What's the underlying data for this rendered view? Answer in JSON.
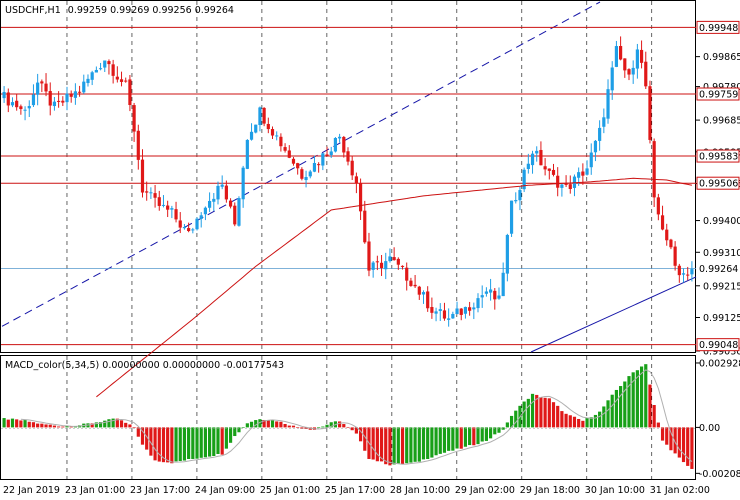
{
  "header": {
    "symbol_label": "USDCHF,H1",
    "ohlc_label": "0.99259 0.99269 0.99256 0.99264"
  },
  "colors": {
    "bull": "#1e9ee6",
    "bear": "#e01818",
    "ma": "#cc1111",
    "hline": "#cc1111",
    "trend": "#1616a8",
    "macd_up": "#18a018",
    "macd_down": "#e01818",
    "signal": "#b0b0b0",
    "current": "#5599cc"
  },
  "chart_data": [
    {
      "type": "candlestick",
      "title": "USDCHF,H1",
      "price_range": [
        0.9903,
        1.0002
      ],
      "y_ticks": [
        "0.99865",
        "0.99780",
        "0.99685",
        "0.99595",
        "0.99505",
        "0.99400",
        "0.99310",
        "0.99215",
        "0.99125",
        "0.99030"
      ],
      "horizontal_levels": [
        "0.99948",
        "0.99759",
        "0.99583",
        "0.99506",
        "0.99048"
      ],
      "current_price": "0.99264",
      "x_labels": [
        "22 Jan 2019",
        "23 Jan 01:00",
        "23 Jan 17:00",
        "24 Jan 09:00",
        "25 Jan 01:00",
        "25 Jan 17:00",
        "28 Jan 10:00",
        "29 Jan 02:00",
        "29 Jan 18:00",
        "30 Jan 10:00",
        "31 Jan 02:00"
      ],
      "bar_count": 165,
      "anchors": [
        [
          0,
          0.9975
        ],
        [
          5,
          0.9971
        ],
        [
          8,
          0.9979
        ],
        [
          12,
          0.9972
        ],
        [
          18,
          0.9977
        ],
        [
          24,
          0.9986
        ],
        [
          29,
          0.9978
        ],
        [
          31,
          0.9966
        ],
        [
          33,
          0.9949
        ],
        [
          36,
          0.9945
        ],
        [
          40,
          0.9942
        ],
        [
          44,
          0.9936
        ],
        [
          48,
          0.9945
        ],
        [
          52,
          0.995
        ],
        [
          55,
          0.9939
        ],
        [
          58,
          0.9964
        ],
        [
          61,
          0.9971
        ],
        [
          66,
          0.9962
        ],
        [
          71,
          0.9953
        ],
        [
          75,
          0.9957
        ],
        [
          80,
          0.9964
        ],
        [
          84,
          0.9951
        ],
        [
          87,
          0.9926
        ],
        [
          92,
          0.9929
        ],
        [
          97,
          0.9923
        ],
        [
          102,
          0.9915
        ],
        [
          106,
          0.9912
        ],
        [
          110,
          0.9915
        ],
        [
          115,
          0.992
        ],
        [
          118,
          0.9917
        ],
        [
          121,
          0.9944
        ],
        [
          126,
          0.996
        ],
        [
          130,
          0.9953
        ],
        [
          134,
          0.9949
        ],
        [
          139,
          0.9955
        ],
        [
          142,
          0.9965
        ],
        [
          146,
          0.9988
        ],
        [
          149,
          0.998
        ],
        [
          151,
          0.999
        ],
        [
          153,
          0.9978
        ],
        [
          155,
          0.9945
        ],
        [
          158,
          0.9935
        ],
        [
          160,
          0.9927
        ],
        [
          162,
          0.9925
        ],
        [
          164,
          0.99264
        ]
      ],
      "moving_average": [
        [
          22,
          0.989
        ],
        [
          45,
          0.9912
        ],
        [
          60,
          0.9927
        ],
        [
          78,
          0.9943
        ],
        [
          100,
          0.9947
        ],
        [
          125,
          0.995
        ],
        [
          140,
          0.9951
        ],
        [
          150,
          0.9952
        ],
        [
          158,
          0.99515
        ],
        [
          164,
          0.995
        ]
      ]
    },
    {
      "type": "histogram",
      "title": "MACD_color(5,34,5) 0.00000000 0.00000000 -0.00177543",
      "value_range": [
        -0.0023,
        0.0032
      ],
      "y_ticks": [
        "0.0029283",
        "0.00",
        "-0.002088"
      ],
      "anchors": [
        [
          0,
          0.0004
        ],
        [
          5,
          0.0003
        ],
        [
          9,
          0.00015
        ],
        [
          14,
          5e-05
        ],
        [
          18,
          0.0001
        ],
        [
          24,
          0.0003
        ],
        [
          27,
          0.0004
        ],
        [
          31,
          0.0
        ],
        [
          33,
          -0.0008
        ],
        [
          36,
          -0.0015
        ],
        [
          40,
          -0.0016
        ],
        [
          46,
          -0.0014
        ],
        [
          52,
          -0.0012
        ],
        [
          55,
          -0.0004
        ],
        [
          58,
          0.0002
        ],
        [
          61,
          0.0004
        ],
        [
          65,
          0.0003
        ],
        [
          70,
          0.0
        ],
        [
          74,
          -0.0001
        ],
        [
          78,
          0.0002
        ],
        [
          80,
          0.0003
        ],
        [
          84,
          -0.0003
        ],
        [
          87,
          -0.0014
        ],
        [
          92,
          -0.0017
        ],
        [
          98,
          -0.0016
        ],
        [
          104,
          -0.0012
        ],
        [
          110,
          -0.0009
        ],
        [
          115,
          -0.0006
        ],
        [
          119,
          -0.0001
        ],
        [
          122,
          0.0008
        ],
        [
          126,
          0.0015
        ],
        [
          130,
          0.0013
        ],
        [
          134,
          0.0006
        ],
        [
          138,
          0.0003
        ],
        [
          142,
          0.0007
        ],
        [
          146,
          0.0017
        ],
        [
          150,
          0.0025
        ],
        [
          153,
          0.0029
        ],
        [
          155,
          0.001
        ],
        [
          157,
          -0.0006
        ],
        [
          160,
          -0.0012
        ],
        [
          162,
          -0.0016
        ],
        [
          164,
          -0.0019
        ]
      ]
    }
  ]
}
